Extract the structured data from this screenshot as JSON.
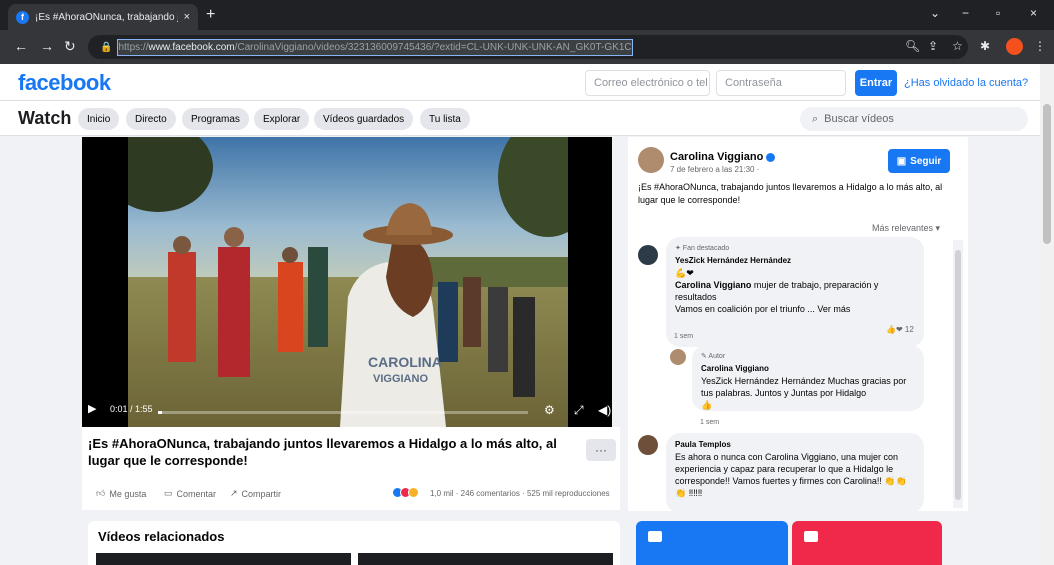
{
  "browser": {
    "tab_title": "¡Es #AhoraONunca, trabajando j",
    "tab_close": "×",
    "new_tab": "+",
    "url_prefix": "https://",
    "url_host": "www.facebook.com",
    "url_path": "/CarolinaViggiano/videos/323136009745436/?extid=CL-UNK-UNK-UNK-AN_GK0T-GK1C",
    "window_controls": [
      "⌄",
      "−",
      "▫",
      "×"
    ]
  },
  "header": {
    "logo": "facebook",
    "email_placeholder": "Correo electrónico o tel",
    "password_placeholder": "Contraseña",
    "login_label": "Entrar",
    "forgot_label": "¿Has olvidado la cuenta?"
  },
  "watchbar": {
    "title": "Watch",
    "tabs": [
      "Inicio",
      "Directo",
      "Programas",
      "Explorar",
      "Vídeos guardados",
      "Tu lista"
    ],
    "search_placeholder": "Buscar vídeos"
  },
  "video": {
    "time": "0:01 / 1:55",
    "progress_fraction": 0.01,
    "title": "¡Es #AhoraONunca, trabajando juntos llevaremos a Hidalgo a lo más alto, al lugar que le corresponde!",
    "more_label": "···",
    "like_label": "Me gusta",
    "comment_label": "Comentar",
    "share_label": "Compartir",
    "reactions_count": "1,0 mil",
    "comments_count": "246 comentarios",
    "views": "525 mil reproducciones",
    "shirt_text": "CAROLINA VIGGIANO"
  },
  "post": {
    "author": "Carolina Viggiano",
    "date": "7 de febrero a las 21:30 · ",
    "follow_label": "Seguir",
    "text": "¡Es #AhoraONunca, trabajando juntos llevaremos a Hidalgo a lo más alto, al lugar que le corresponde!",
    "sort_label": "Más relevantes ▾"
  },
  "comments": [
    {
      "badge": "✦ Fan destacado",
      "name": "YesZick Hernández Hernández",
      "emoji": "💪❤",
      "text_name": "Carolina Viggiano",
      "text": " mujer de trabajo, preparación y resultados",
      "text2": "Vamos en coalición por el triunfo ... Ver más",
      "time": "1 sem",
      "reacts": "12"
    },
    {
      "badge": "✎ Autor",
      "name": "Carolina Viggiano",
      "text": "YesZick Hernández Hernández Muchas gracias por tus palabras. Juntos y Juntas por Hidalgo",
      "emoji": "👍",
      "time": "1 sem"
    },
    {
      "name": "Paula Templos",
      "text": "Es ahora o nunca con Carolina Viggiano, una mujer con experiencia y capaz para recuperar lo que a Hidalgo le corresponde!! Vamos fuertes y firmes con Carolina!! 👏👏👏 ‼‼‼"
    }
  ],
  "related": {
    "title": "Vídeos relacionados"
  },
  "colors": {
    "brand": "#1877f2",
    "red_card": "#f02849"
  }
}
